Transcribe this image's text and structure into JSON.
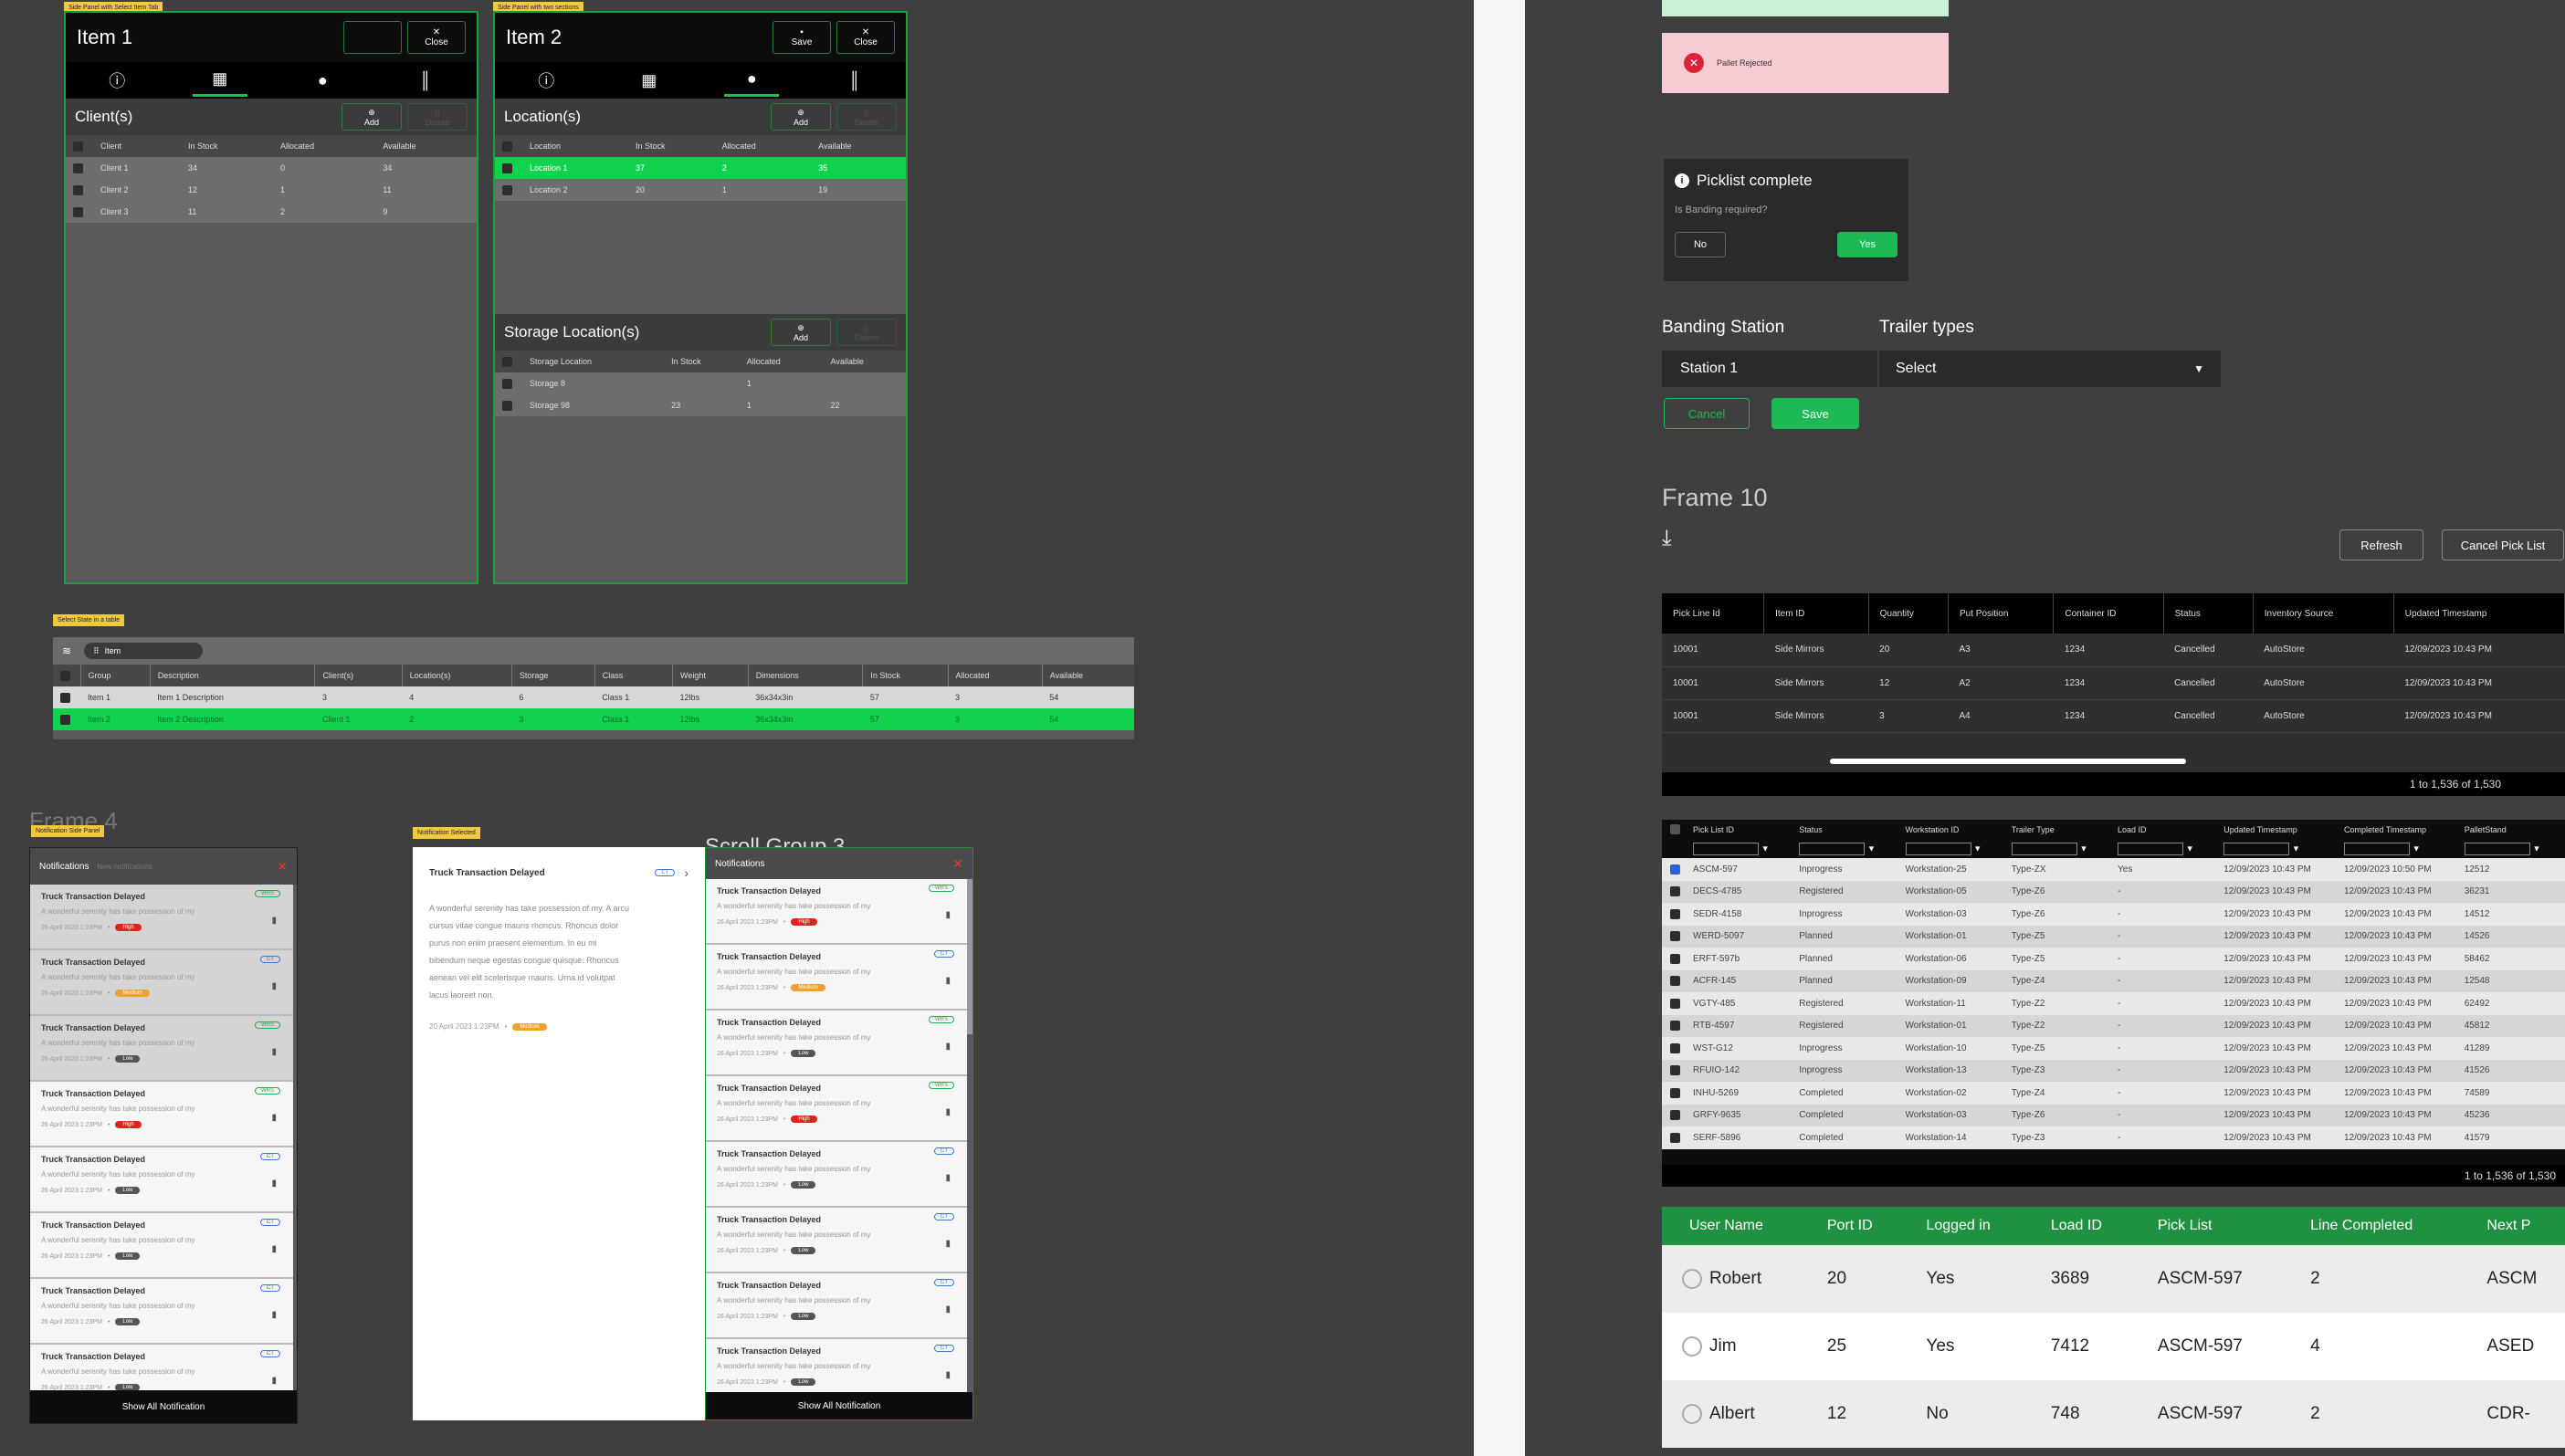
{
  "panel1": {
    "tag": "Side Panel with Select Item Tab",
    "title": "Item 1",
    "close": "Close",
    "section": "Client(s)",
    "add": "Add",
    "delete": "Delete",
    "headers": [
      "Client",
      "In Stock",
      "Allocated",
      "Available"
    ],
    "rows": [
      [
        "Client 1",
        "34",
        "0",
        "34"
      ],
      [
        "Client 2",
        "12",
        "1",
        "11"
      ],
      [
        "Client 3",
        "11",
        "2",
        "9"
      ]
    ]
  },
  "panel2": {
    "tag": "Side Panel with two sections",
    "title": "Item 2",
    "save": "Save",
    "close": "Close",
    "section": "Location(s)",
    "add": "Add",
    "delete": "Delete",
    "headers": [
      "Location",
      "In Stock",
      "Allocated",
      "Available"
    ],
    "rows": [
      [
        "Location 1",
        "37",
        "2",
        "35"
      ],
      [
        "Location 2",
        "20",
        "1",
        "19"
      ]
    ],
    "section2": "Storage Location(s)",
    "headers2": [
      "Storage Location",
      "In Stock",
      "Allocated",
      "Available"
    ],
    "rows2": [
      [
        "Storage 8",
        "",
        "1",
        ""
      ],
      [
        "Storage 98",
        "23",
        "1",
        "22"
      ]
    ]
  },
  "stateTable": {
    "tag": "Select State in a table",
    "search": "Item",
    "headers": [
      "Group",
      "Description",
      "Client(s)",
      "Location(s)",
      "Storage",
      "Class",
      "Weight",
      "Dimensions",
      "In Stock",
      "Allocated",
      "Available"
    ],
    "rows": [
      [
        "Item 1",
        "Item 1 Description",
        "3",
        "4",
        "6",
        "Class 1",
        "12lbs",
        "36x34x3in",
        "57",
        "3",
        "54"
      ],
      [
        "Item 2",
        "Item 2 Description",
        "Client 1",
        "2",
        "3",
        "Class 1",
        "12lbs",
        "36x34x3in",
        "57",
        "3",
        "54"
      ]
    ]
  },
  "frame4": {
    "label": "Frame 4",
    "tag": "Notification Side Panel",
    "title": "Notifications",
    "subtitle": "New notifications",
    "footer": "Show All Notification"
  },
  "notifSel": {
    "tag": "Notification Selected",
    "title": "Truck Transaction Delayed",
    "code": "CT",
    "body": "A wonderful serenity has take possession of my. A arcu cursus vitae congue mauris rhoncus. Rhoncus dolor purus non enim praesent elementum. In eu mi bibendum neque egestas congue quisque. Rhoncus aenean vel elit scelerisque mauris. Urna id volutpat lacus laoreet non.",
    "date": "20 April 2023 1:23PM",
    "priority": "Medium"
  },
  "scroll3": {
    "label": "Scroll Group 3",
    "title": "Notifications",
    "footer": "Show All Notification"
  },
  "notifText": {
    "title": "Truck Transaction Delayed",
    "desc": "A wonderful serenity has take possession of my",
    "date": "26 April 2023 1:23PM"
  },
  "notifs": [
    {
      "code": "WRS",
      "pri": "High",
      "col": "#e0231c"
    },
    {
      "code": "CT",
      "pri": "Medium",
      "col": "#f0a030"
    },
    {
      "code": "WRS",
      "pri": "Low",
      "col": "#555"
    },
    {
      "code": "WRS",
      "pri": "High",
      "col": "#e0231c"
    },
    {
      "code": "CT",
      "pri": "Low",
      "col": "#555"
    },
    {
      "code": "CT",
      "pri": "Low",
      "col": "#555"
    },
    {
      "code": "CT",
      "pri": "Low",
      "col": "#555"
    },
    {
      "code": "CT",
      "pri": "Low",
      "col": "#555"
    }
  ],
  "notifs2": [
    {
      "code": "WRS",
      "pri": "High",
      "col": "#e0231c"
    },
    {
      "code": "CT",
      "pri": "Medium",
      "col": "#f0a030"
    },
    {
      "code": "WRS",
      "pri": "Low",
      "col": "#555"
    },
    {
      "code": "WRS",
      "pri": "High",
      "col": "#e0231c"
    },
    {
      "code": "CT",
      "pri": "Low",
      "col": "#555"
    },
    {
      "code": "CT",
      "pri": "Low",
      "col": "#555"
    },
    {
      "code": "CT",
      "pri": "Low",
      "col": "#555"
    },
    {
      "code": "CT",
      "pri": "Low",
      "col": "#555"
    }
  ],
  "alert": {
    "text": "Pallet Rejected"
  },
  "dialog": {
    "title": "Picklist complete",
    "question": "Is Banding required?",
    "no": "No",
    "yes": "Yes"
  },
  "banding": {
    "label1": "Banding Station",
    "label2": "Trailer types",
    "station": "Station 1",
    "select": "Select",
    "cancel": "Cancel",
    "save": "Save"
  },
  "frame10": {
    "label": "Frame 10",
    "refresh": "Refresh",
    "cancel": "Cancel Pick List",
    "headers": [
      "Pick Line Id",
      "Item ID",
      "Quantity",
      "Put Position",
      "Container ID",
      "Status",
      "Inventory Source",
      "Updated Timestamp"
    ],
    "rows": [
      [
        "10001",
        "Side Mirrors",
        "20",
        "A3",
        "1234",
        "Cancelled",
        "AutoStore",
        "12/09/2023 10:43 PM"
      ],
      [
        "10001",
        "Side Mirrors",
        "12",
        "A2",
        "1234",
        "Cancelled",
        "AutoStore",
        "12/09/2023 10:43 PM"
      ],
      [
        "10001",
        "Side Mirrors",
        "3",
        "A4",
        "1234",
        "Cancelled",
        "AutoStore",
        "12/09/2023 10:43 PM"
      ]
    ],
    "pager": "1 to 1,536 of 1,530"
  },
  "pickTable": {
    "headers": [
      "Pick List ID",
      "Status",
      "Workstation ID",
      "Trailer Type",
      "Load ID",
      "Updated Timestamp",
      "Completed Timestamp",
      "PalletStand"
    ],
    "rows": [
      [
        "ASCM-597",
        "Inprogress",
        "Workstation-25",
        "Type-ZX",
        "Yes",
        "12/09/2023 10:43 PM",
        "12/09/2023 10:50 PM",
        "12512"
      ],
      [
        "DECS-4785",
        "Registered",
        "Workstation-05",
        "Type-Z6",
        "-",
        "12/09/2023 10:43 PM",
        "12/09/2023 10:43 PM",
        "36231"
      ],
      [
        "SEDR-4158",
        "Inprogress",
        "Workstation-03",
        "Type-Z6",
        "-",
        "12/09/2023 10:43 PM",
        "12/09/2023 10:43 PM",
        "14512"
      ],
      [
        "WERD-5097",
        "Planned",
        "Workstation-01",
        "Type-Z5",
        "-",
        "12/09/2023 10:43 PM",
        "12/09/2023 10:43 PM",
        "14526"
      ],
      [
        "ERFT-597b",
        "Planned",
        "Workstation-06",
        "Type-Z5",
        "-",
        "12/09/2023 10:43 PM",
        "12/09/2023 10:43 PM",
        "58462"
      ],
      [
        "ACFR-145",
        "Planned",
        "Workstation-09",
        "Type-Z4",
        "-",
        "12/09/2023 10:43 PM",
        "12/09/2023 10:43 PM",
        "12548"
      ],
      [
        "VGTY-485",
        "Registered",
        "Workstation-11",
        "Type-Z2",
        "-",
        "12/09/2023 10:43 PM",
        "12/09/2023 10:43 PM",
        "62492"
      ],
      [
        "RTB-4597",
        "Registered",
        "Workstation-01",
        "Type-Z2",
        "-",
        "12/09/2023 10:43 PM",
        "12/09/2023 10:43 PM",
        "45812"
      ],
      [
        "WST-G12",
        "Inprogress",
        "Workstation-10",
        "Type-Z5",
        "-",
        "12/09/2023 10:43 PM",
        "12/09/2023 10:43 PM",
        "41289"
      ],
      [
        "RFUIO-142",
        "Inprogress",
        "Workstation-13",
        "Type-Z3",
        "-",
        "12/09/2023 10:43 PM",
        "12/09/2023 10:43 PM",
        "41526"
      ],
      [
        "INHU-5269",
        "Completed",
        "Workstation-02",
        "Type-Z4",
        "-",
        "12/09/2023 10:43 PM",
        "12/09/2023 10:43 PM",
        "74589"
      ],
      [
        "GRFY-9635",
        "Completed",
        "Workstation-03",
        "Type-Z6",
        "-",
        "12/09/2023 10:43 PM",
        "12/09/2023 10:43 PM",
        "45236"
      ],
      [
        "SERF-5896",
        "Completed",
        "Workstation-14",
        "Type-Z3",
        "-",
        "12/09/2023 10:43 PM",
        "12/09/2023 10:43 PM",
        "41579"
      ]
    ],
    "pager": "1 to 1,536 of 1,530"
  },
  "userTable": {
    "headers": [
      "User Name",
      "Port ID",
      "Logged in",
      "Load ID",
      "Pick List",
      "Line Completed",
      "Next P"
    ],
    "rows": [
      [
        "Robert",
        "20",
        "Yes",
        "3689",
        "ASCM-597",
        "2",
        "ASCM"
      ],
      [
        "Jim",
        "25",
        "Yes",
        "7412",
        "ASCM-597",
        "4",
        "ASED"
      ],
      [
        "Albert",
        "12",
        "No",
        "748",
        "ASCM-597",
        "2",
        "CDR-"
      ]
    ]
  }
}
